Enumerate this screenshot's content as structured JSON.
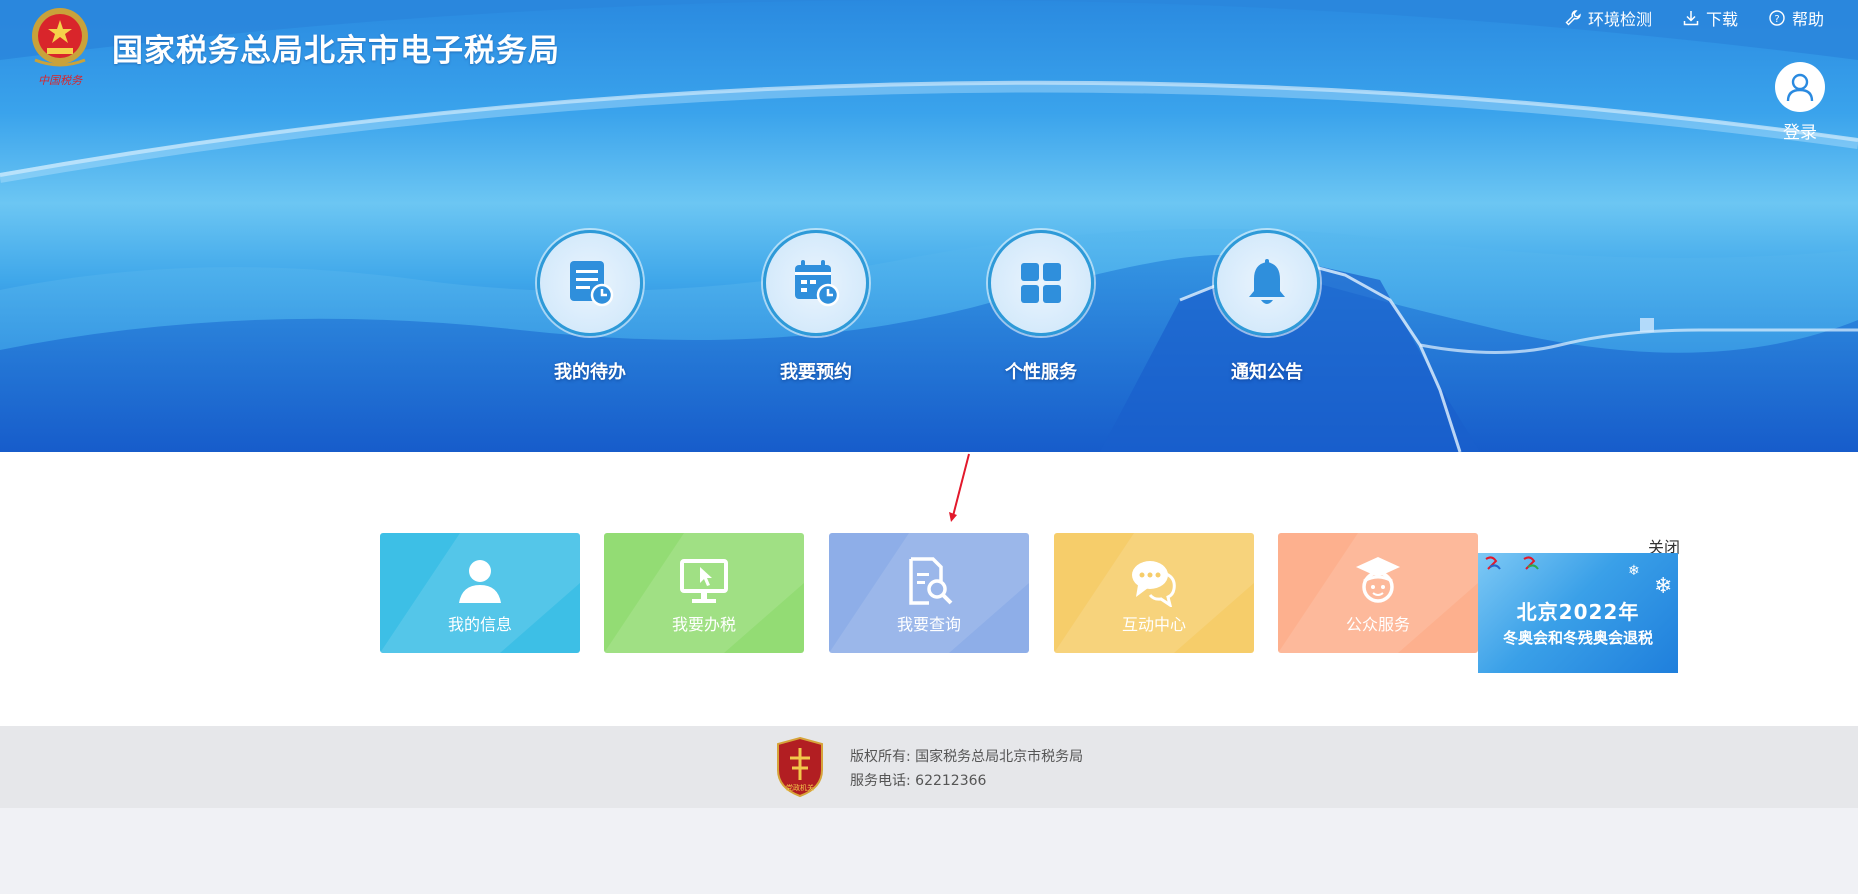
{
  "header": {
    "site_title": "国家税务总局北京市电子税务局",
    "emblem_caption": "中国税务",
    "top_links": [
      {
        "label": "环境检测",
        "icon": "wrench-icon"
      },
      {
        "label": "下载",
        "icon": "download-icon"
      },
      {
        "label": "帮助",
        "icon": "help-icon"
      }
    ],
    "login_label": "登录"
  },
  "quick_entries": [
    {
      "label": "我的待办",
      "icon": "todo-list-icon"
    },
    {
      "label": "我要预约",
      "icon": "calendar-icon"
    },
    {
      "label": "个性服务",
      "icon": "grid-icon"
    },
    {
      "label": "通知公告",
      "icon": "bell-icon"
    }
  ],
  "tiles": [
    {
      "label": "我的信息",
      "icon": "user-icon",
      "color": "#3dbfe6"
    },
    {
      "label": "我要办税",
      "icon": "monitor-icon",
      "color": "#93dc74"
    },
    {
      "label": "我要查询",
      "icon": "document-search-icon",
      "color": "#8eaee8"
    },
    {
      "label": "互动中心",
      "icon": "chat-icon",
      "color": "#f6cd6a"
    },
    {
      "label": "公众服务",
      "icon": "graduate-icon",
      "color": "#fdb08e"
    }
  ],
  "banner": {
    "close_label": "关闭",
    "line1": "北京2022年",
    "line2": "冬奥会和冬残奥会退税"
  },
  "footer": {
    "copyright": "版权所有: 国家税务总局北京市税务局",
    "phone": "服务电话: 62212366",
    "badge_text": "党政机关"
  },
  "colors": {
    "brand_blue": "#2a8ae0",
    "ring_border": "#2e9ad8",
    "icon_blue": "#2f8fdc"
  }
}
